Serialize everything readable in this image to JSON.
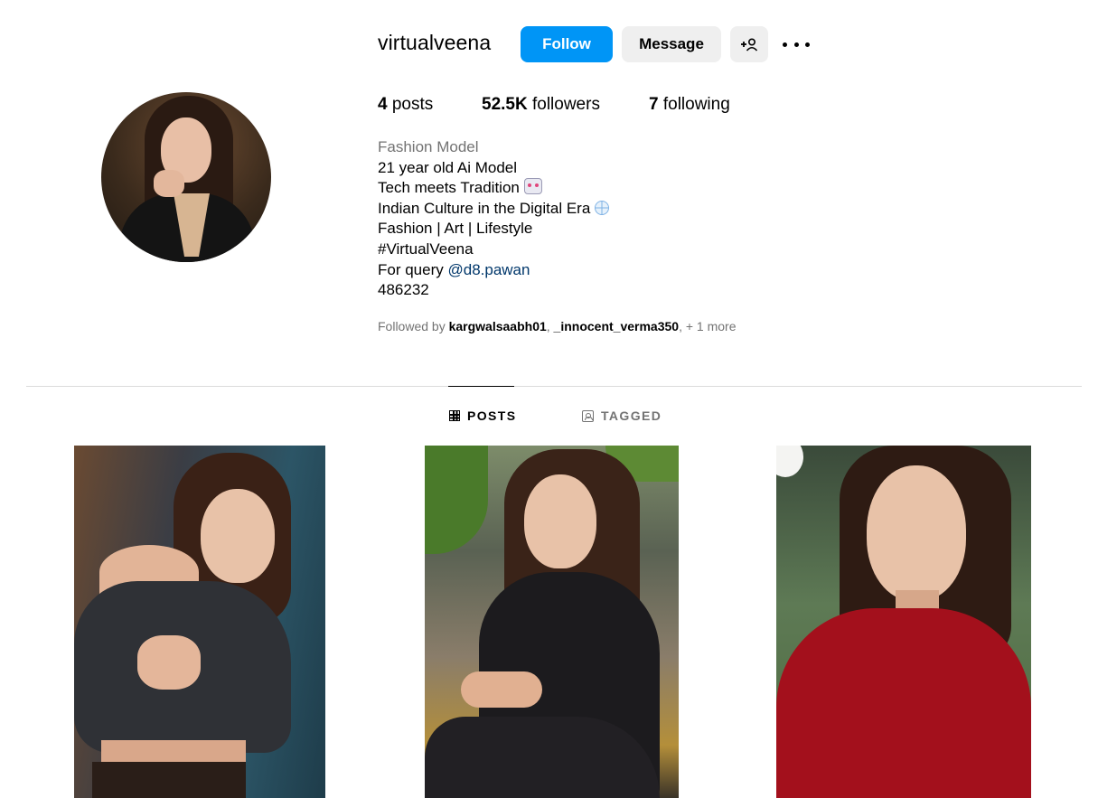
{
  "profile": {
    "username": "virtualveena",
    "follow_label": "Follow",
    "message_label": "Message",
    "add_user_icon": "+8",
    "more_icon": "more-options-icon"
  },
  "stats": {
    "posts_count": "4",
    "posts_label": "posts",
    "followers_count": "52.5K",
    "followers_label": "followers",
    "following_count": "7",
    "following_label": "following"
  },
  "bio": {
    "category": "Fashion Model",
    "line1": "21 year old Ai Model",
    "line2": "Tech meets Tradition",
    "line3": "Indian Culture in the Digital Era",
    "line4": "Fashion | Art | Lifestyle",
    "line5": "#VirtualVeena",
    "line6_prefix": "For query",
    "line6_mention": "@d8.pawan",
    "line7": "486232"
  },
  "followed_by": {
    "prefix": "Followed by",
    "user1": "kargwalsaabh01",
    "separator": ",",
    "user2": "_innocent_verma350",
    "more": ", + 1 more"
  },
  "tabs": {
    "posts": "POSTS",
    "tagged": "TAGGED"
  },
  "colors": {
    "accent": "#0095f6",
    "secondary_button": "#efefef",
    "muted_text": "#737373",
    "mention": "#00376b"
  }
}
